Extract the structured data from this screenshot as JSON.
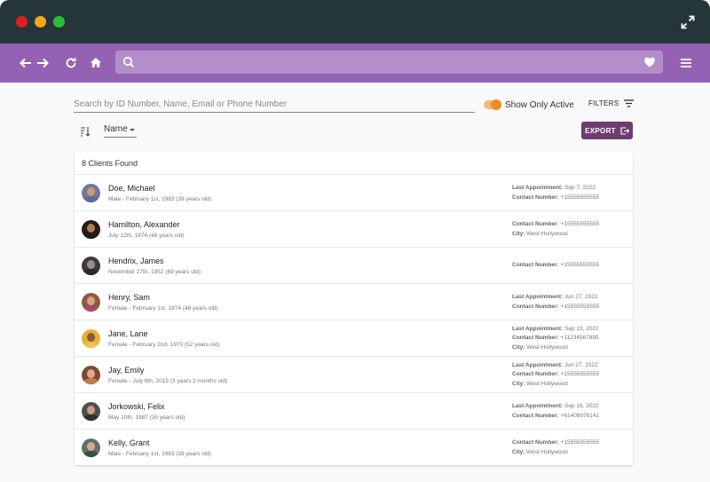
{
  "colors": {
    "titlebar": "#253638",
    "navbar": "#9462b3",
    "accent_button": "#6e3d70",
    "toggle": "#f28a1f"
  },
  "icons": {
    "window": [
      "close-dot",
      "minimize-dot",
      "maximize-dot",
      "expand-icon"
    ],
    "nav": [
      "back-arrow-icon",
      "forward-arrow-icon",
      "reload-icon",
      "home-icon",
      "search-icon",
      "heart-icon",
      "hamburger-menu-icon"
    ]
  },
  "search": {
    "placeholder": "Search by ID Number, Name, Email or Phone Number",
    "value": ""
  },
  "toggle": {
    "label": "Show Only Active",
    "on": true
  },
  "filters_label": "FILTERS",
  "sort": {
    "selected": "Name"
  },
  "export_label": "EXPORT",
  "results": {
    "header": "8 Clients Found"
  },
  "labels": {
    "last_appointment": "Last Appointment:",
    "contact_number": "Contact Number:",
    "city": "City:"
  },
  "clients": [
    {
      "name": "Doe, Michael",
      "sub": "Male - February 1st, 1983 (39 years old)",
      "last_appointment": "Sep 7, 2022",
      "contact": "+15555555555",
      "city": null
    },
    {
      "name": "Hamilton, Alexander",
      "sub": "July 12th, 1974 (48 years old)",
      "last_appointment": null,
      "contact": "+15555555555",
      "city": "West Hollywood"
    },
    {
      "name": "Hendrix, James",
      "sub": "November 27th, 1952 (69 years old)",
      "last_appointment": null,
      "contact": "+15555555555",
      "city": null
    },
    {
      "name": "Henry, Sam",
      "sub": "Female - February 1st, 1974 (48 years old)",
      "last_appointment": "Jun 27, 2022",
      "contact": "+15555555555",
      "city": null
    },
    {
      "name": "Jane, Lane",
      "sub": "Female - February 2nd, 1970 (52 years old)",
      "last_appointment": "Sep 13, 2022",
      "contact": "+11234567895",
      "city": "West Hollywood"
    },
    {
      "name": "Jay, Emily",
      "sub": "Female - July 6th, 2019 (3 years 2 months old)",
      "last_appointment": "Jun 27, 2022",
      "contact": "+15555555555",
      "city": "West Hollywood"
    },
    {
      "name": "Jorkowski, Felix",
      "sub": "May 10th, 1987 (35 years old)",
      "last_appointment": "Sep 16, 2022",
      "contact": "+61409976141",
      "city": null
    },
    {
      "name": "Kelly, Grant",
      "sub": "Male - February 1st, 1983 (39 years old)",
      "last_appointment": null,
      "contact": "+15555555555",
      "city": "West Hollywood"
    }
  ]
}
